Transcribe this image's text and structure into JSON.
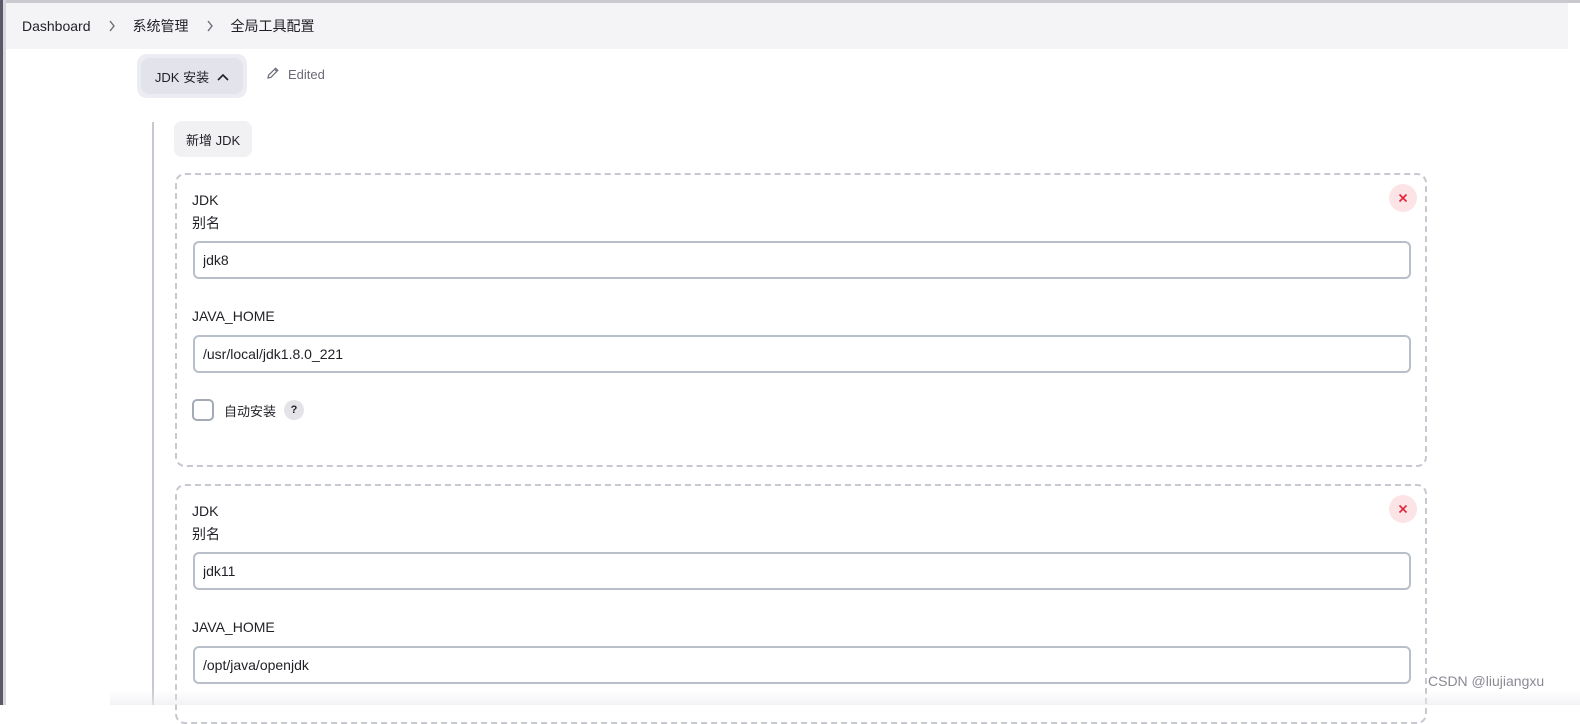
{
  "breadcrumb": {
    "items": [
      "Dashboard",
      "系统管理",
      "全局工具配置"
    ]
  },
  "section": {
    "tab_label": "JDK 安装",
    "edited_label": "Edited",
    "add_button_label": "新增 JDK"
  },
  "jdks": [
    {
      "title": "JDK",
      "alias_label": "别名",
      "alias_value": "jdk8",
      "java_home_label": "JAVA_HOME",
      "java_home_value": "/usr/local/jdk1.8.0_221",
      "auto_install_label": "自动安装",
      "help_label": "?"
    },
    {
      "title": "JDK",
      "alias_label": "别名",
      "alias_value": "jdk11",
      "java_home_label": "JAVA_HOME",
      "java_home_value": "/opt/java/openjdk"
    }
  ],
  "watermark": "CSDN @liujiangxu",
  "colors": {
    "close_icon": "#e0243a",
    "close_bg": "#fbe3e6",
    "breadcrumb_bg": "#f4f4f6"
  }
}
